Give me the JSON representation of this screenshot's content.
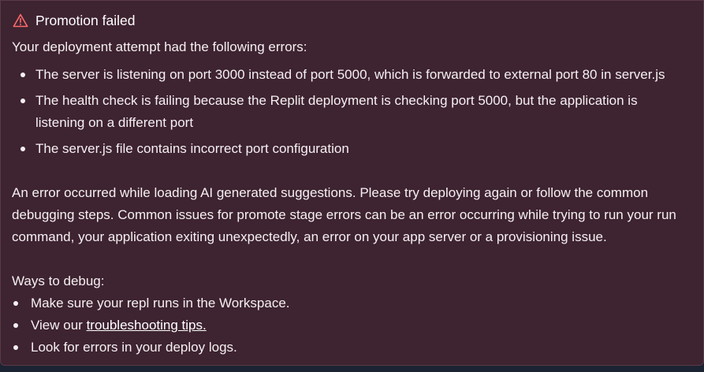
{
  "alert": {
    "icon": "warning-triangle-icon",
    "icon_color": "#ff6b6b",
    "background_color": "#3e2330",
    "title": "Promotion failed",
    "intro": "Your deployment attempt had the following errors:",
    "errors": [
      "The server is listening on port 3000 instead of port 5000, which is forwarded to external port 80 in server.js",
      "The health check is failing because the Replit deployment is checking port 5000, but the application is listening on a different port",
      "The server.js file contains incorrect port configuration"
    ],
    "message": "An error occurred while loading AI generated suggestions. Please try deploying again or follow the common debugging steps. Common issues for promote stage errors can be an error occurring while trying to run your run command, your application exiting unexpectedly, an error on your app server or a provisioning issue.",
    "debug": {
      "heading": "Ways to debug:",
      "item_1": "Make sure your repl runs in the Workspace.",
      "item_2_prefix": "View our ",
      "item_2_link": "troubleshooting tips.",
      "item_3": "Look for errors in your deploy logs."
    }
  }
}
